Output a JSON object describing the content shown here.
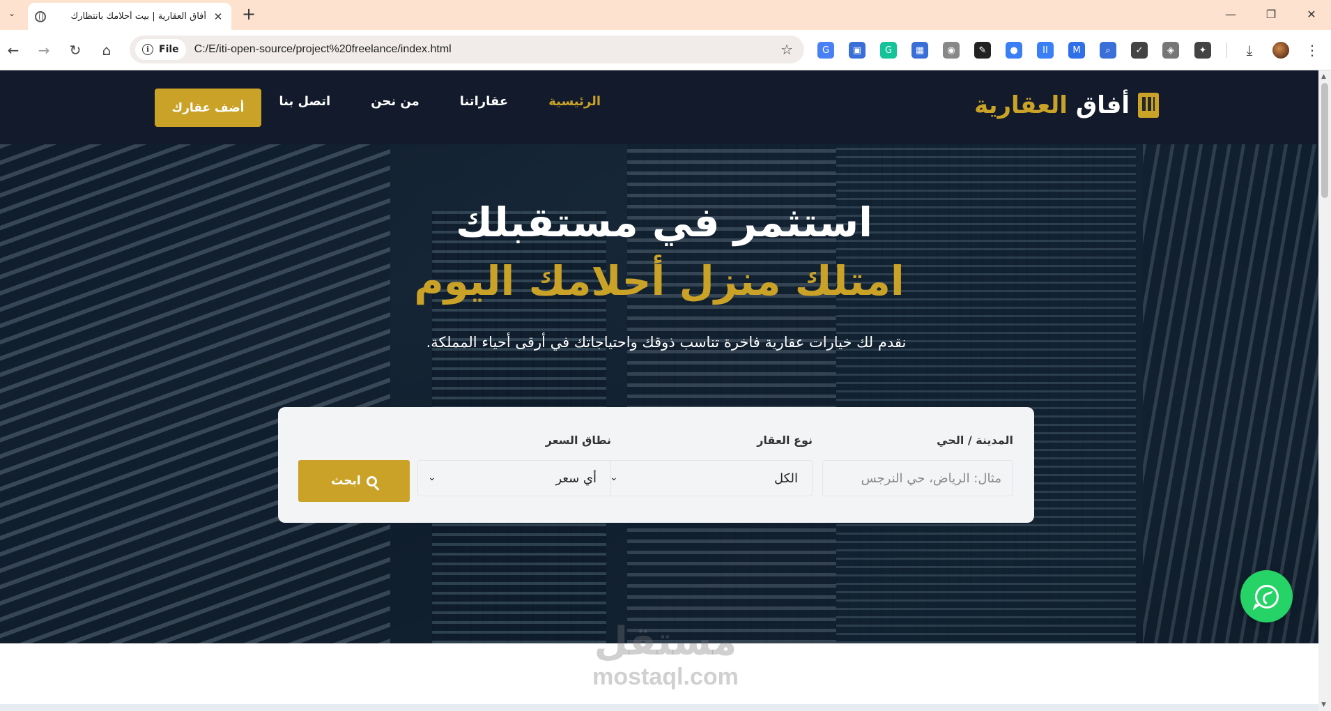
{
  "browser": {
    "tab_title": "أفاق العقارية | بيت أحلامك بانتظارك",
    "tab_close": "✕",
    "new_tab": "+",
    "tab_menu": "⌄",
    "win_minimize": "—",
    "win_restore": "❐",
    "win_close": "✕",
    "chip_label": "File",
    "chip_info": "i",
    "url": "C:/E/iti-open-source/project%20freelance/index.html",
    "back": "←",
    "forward": "→",
    "reload": "↻",
    "home": "⌂",
    "star": "☆",
    "menu": "⋮",
    "downloads": "⤓",
    "extensions": [
      {
        "name": "translate-icon",
        "glyph": "G",
        "color": "#4a80f5"
      },
      {
        "name": "cast-icon",
        "glyph": "▣",
        "color": "#3a6fd8"
      },
      {
        "name": "grammarly-icon",
        "glyph": "G",
        "color": "#15c39a"
      },
      {
        "name": "table-icon",
        "glyph": "▦",
        "color": "#3a6fd8"
      },
      {
        "name": "camera-icon",
        "glyph": "◉",
        "color": "#888888"
      },
      {
        "name": "eyedropper-icon",
        "glyph": "✎",
        "color": "#222222"
      },
      {
        "name": "dot-icon",
        "glyph": "●",
        "color": "#3b7ff5"
      },
      {
        "name": "pause-icon",
        "glyph": "II",
        "color": "#3b7ff5"
      },
      {
        "name": "m-icon",
        "glyph": "M",
        "color": "#2f6fe8"
      },
      {
        "name": "lens-icon",
        "glyph": "⌕",
        "color": "#3a6fd8"
      },
      {
        "name": "check-icon",
        "glyph": "✓",
        "color": "#444444"
      },
      {
        "name": "shield-icon",
        "glyph": "◈",
        "color": "#777777"
      },
      {
        "name": "puzzle-icon",
        "glyph": "✦",
        "color": "#444444"
      }
    ]
  },
  "site": {
    "brand_word1": "أفاق",
    "brand_word2": "العقارية",
    "nav": {
      "home": "الرئيسية",
      "properties": "عقاراتنا",
      "about": "من نحن",
      "contact": "اتصل بنا"
    },
    "add_property": "أضف عقارك",
    "accent_color": "#c9a227",
    "navbar_color": "#121a2b"
  },
  "hero": {
    "title_line1": "استثمر في مستقبلك",
    "title_line2": "امتلك منزل أحلامك اليوم",
    "subtitle": "نقدم لك خيارات عقارية فاخرة تناسب ذوقك واحتياجاتك في أرقى أحياء المملكة."
  },
  "search": {
    "city_label": "المدينة / الحي",
    "city_placeholder": "مثال: الرياض، حي النرجس",
    "type_label": "نوع العقار",
    "type_value": "الكل",
    "price_label": "نطاق السعر",
    "price_value": "أي سعر",
    "button": "ابحث"
  },
  "watermark": {
    "ar": "مستقل",
    "en": "mostaql.com"
  }
}
